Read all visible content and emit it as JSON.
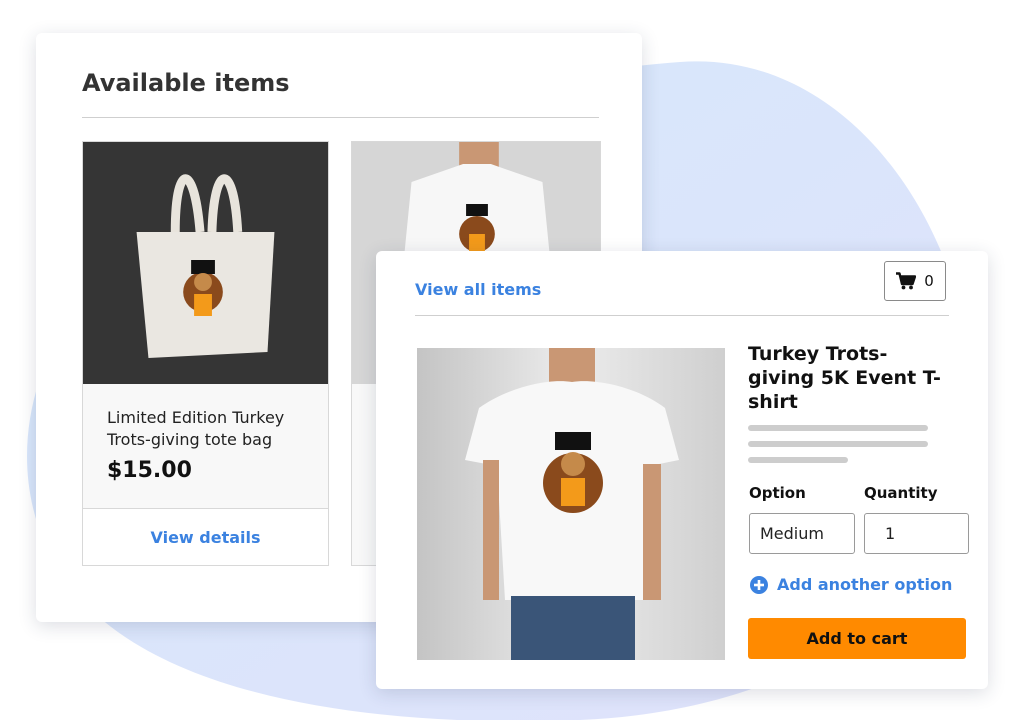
{
  "available": {
    "title": "Available items",
    "products": [
      {
        "name": "Limited Edition Turkey Trots-giving tote bag",
        "price": "$15.00",
        "link": "View details"
      }
    ]
  },
  "detail": {
    "view_all": "View all items",
    "cart_count": "0",
    "title": "Turkey Trots-giving 5K Event T-shirt",
    "option_label": "Option",
    "quantity_label": "Quantity",
    "option_value": "Medium",
    "quantity_value": "1",
    "add_option": "Add another option",
    "add_to_cart": "Add to cart"
  },
  "colors": {
    "accent_blue": "#3b82e0",
    "cta_orange": "#ff8a00",
    "blob_blue": "#d5e8fb",
    "blob_purple": "#e0e2fb"
  },
  "icons": [
    "cart-icon",
    "plus-circle-icon"
  ]
}
